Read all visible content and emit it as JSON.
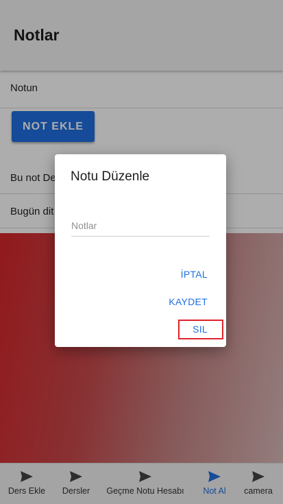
{
  "header": {
    "title": "Notlar"
  },
  "content": {
    "input_value": "Notun",
    "add_button_label": "NOT EKLE",
    "notes": [
      "Bu not De",
      "Bugün dit"
    ]
  },
  "dialog": {
    "title": "Notu Düzenle",
    "input_placeholder": "Notlar",
    "cancel_label": "İPTAL",
    "save_label": "KAYDET",
    "delete_label": "SIL"
  },
  "tabs": [
    {
      "label": "Ders Ekle",
      "icon": "send-icon",
      "active": false
    },
    {
      "label": "Dersler",
      "icon": "send-icon",
      "active": false
    },
    {
      "label": "Geçme Notu Hesabı",
      "icon": "send-icon",
      "active": false
    },
    {
      "label": "Not Al",
      "icon": "send-icon",
      "active": true
    },
    {
      "label": "camera",
      "icon": "send-icon",
      "active": false
    }
  ],
  "colors": {
    "accent": "#1f6fe0",
    "highlight": "#e0212a",
    "gradient_start": "#d6262a",
    "gradient_end": "#d9b9b9"
  }
}
